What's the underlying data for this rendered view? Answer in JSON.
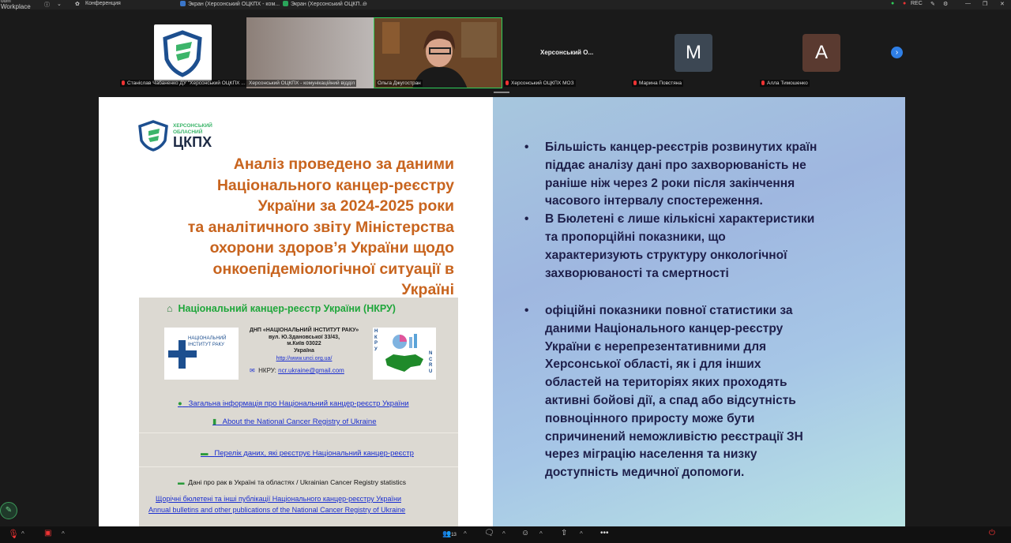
{
  "app": {
    "title_line1": "oom",
    "title_line2": "Workplace"
  },
  "topbar": {
    "conference_label": "Конференция",
    "tabs": [
      {
        "label": "Экран (Херсонський ОЦКПХ - ком..."
      },
      {
        "label": "Экран (Херсонський ОЦКП..."
      }
    ],
    "rec_label": "REC"
  },
  "participants": [
    {
      "name": "Станіслав Чабаненко ДУ \"Херсонський ОЦКПХ ..."
    },
    {
      "name": "Херсонський ОЦКПХ - комунікаційний відділ"
    },
    {
      "name": "Ольга Джугостран"
    },
    {
      "name": "Херсонський ОЦКПХ МОЗ",
      "tile_text": "Херсонський О..."
    },
    {
      "name": "Марина Повстяна",
      "initial": "M"
    },
    {
      "name": "Алла Тимошенко",
      "initial": "A"
    }
  ],
  "slide": {
    "logo": {
      "line1": "ХЕРСОНСЬКИЙ",
      "line2": "ОБЛАСНИЙ",
      "main": "ЦКПХ"
    },
    "title_lines": [
      "Аналіз проведено за даними",
      "Національного канцер-реєстру",
      "України за 2024-2025 роки",
      "та аналітичного звіту Міністерства",
      "охорони здоров’я України щодо",
      "онкоепідеміологічної ситуації в",
      "Україні"
    ],
    "registry": {
      "header": "Національний канцер-реєстр України (НКРУ)",
      "inst_logo_line1": "НАЦІОНАЛЬНИЙ",
      "inst_logo_line2": "ІНСТИТУТ РАКУ",
      "address_lines": [
        "ДНП «НАЦІОНАЛЬНИЙ ІНСТИТУТ РАКУ»",
        "вул. Ю.Здановської 33/43,",
        "м.Київ 03022",
        "Україна"
      ],
      "website": "http://www.unci.org.ua/",
      "email_label": "НКРУ:",
      "email": "ncr.ukraine@gmail.com",
      "nkru_vertical": "НКРУ",
      "ncru_vertical": "NCRU",
      "links": [
        "Загальна інформація про Національний канцер-реєстр України",
        "About the National Cancer Registry of Ukraine",
        "Перелік даних, які реєструє Національний канцер-реєстр"
      ],
      "stats_label": "Дані про рак в Україні та областях / Ukrainian Cancer Registry statistics",
      "bulletin_links": [
        "Щорічні бюлетені та інші публікації Національного канцер-реєстру України",
        "Annual bulletins and other publications of the National Cancer Registry of Ukraine"
      ]
    },
    "bullets_top": [
      [
        "Більшість канцер-реєстрів розвинутих країн",
        "піддає аналізу дані про захворюваність не",
        "раніше ніж через 2 роки після закінчення",
        "часового інтервалу спостереження."
      ],
      [
        "В Бюлетені є лише кількісні характеристики",
        "та пропорційні показники, що",
        "характеризують структуру онкологічної",
        "захворюваності та смертності"
      ]
    ],
    "bullets_bottom": [
      "офіційні показники повної статистики за",
      "даними Національного канцер-реєстру",
      "України є нерепрезентативними для",
      "Херсонської області, як і для інших",
      "областей на територіях яких проходять",
      "активні бойові дії, а спад або відсутність",
      "повноцінного приросту може бути",
      "спричинений неможливістю  реєстрації ЗН",
      "через міграцію населення та низку",
      "доступність  медичної допомоги."
    ]
  },
  "toolbar": {
    "participants_count": "13"
  },
  "colors": {
    "title_orange": "#c8641e",
    "bullet_text": "#1e1f4a",
    "link_blue": "#1b2fd0",
    "nkru_green": "#1ea63a"
  }
}
